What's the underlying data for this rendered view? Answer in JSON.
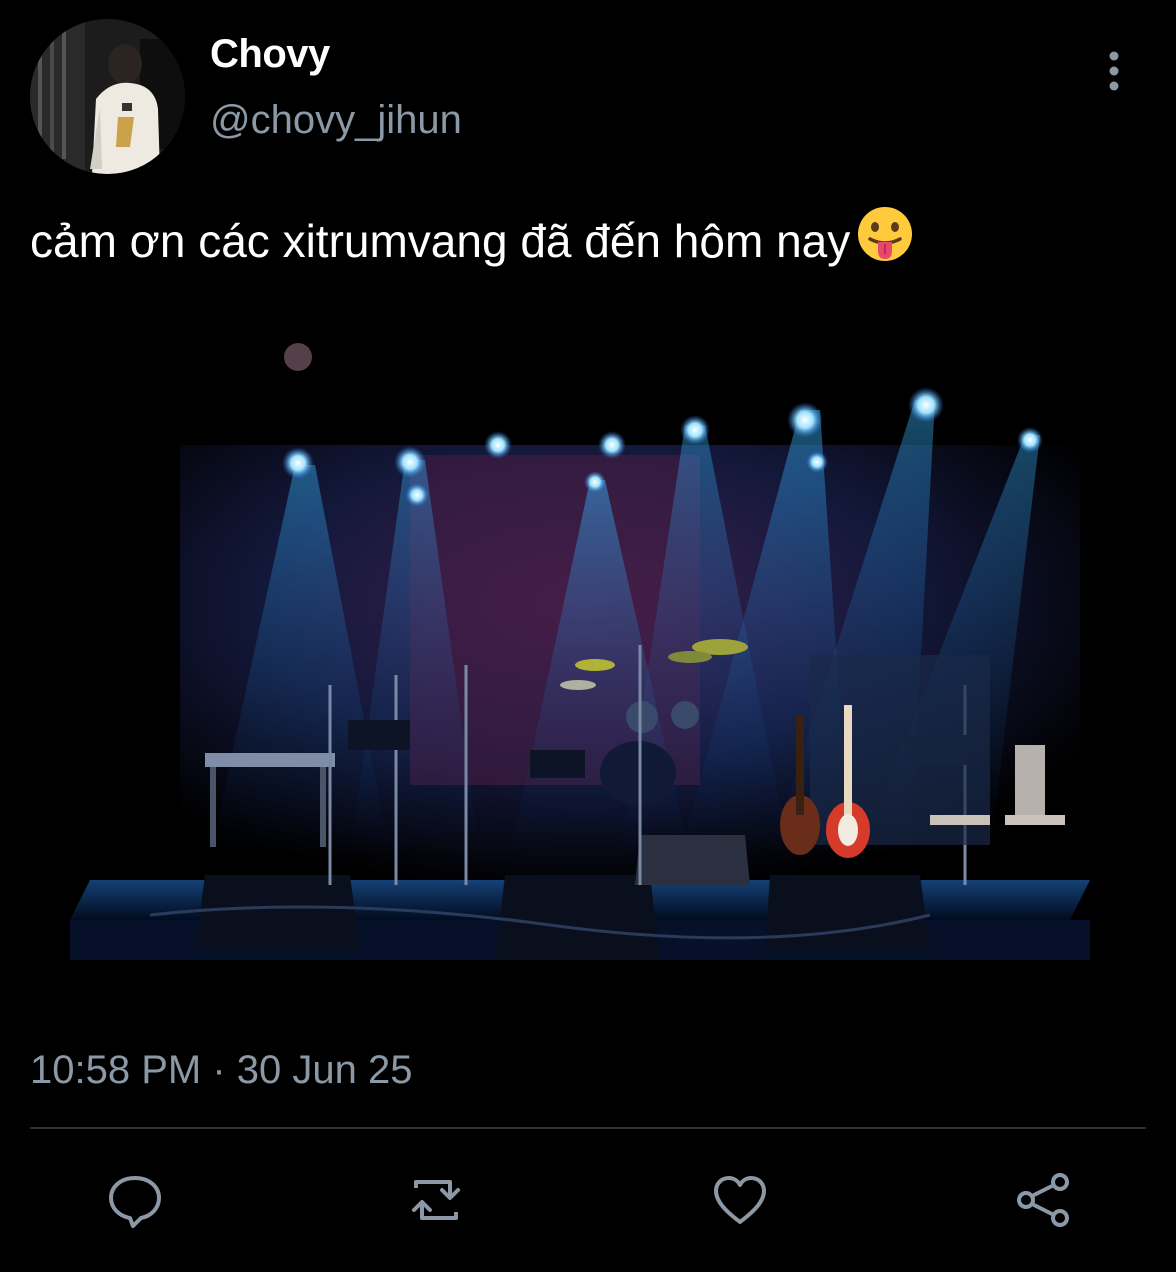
{
  "author": {
    "display_name": "Chovy",
    "handle": "@chovy_jihun",
    "avatar_icon": "profile-photo"
  },
  "tweet": {
    "text": "cảm ơn các xitrumvang đã đến hôm nay",
    "emoji": "face-with-tongue",
    "timestamp": "10:58 PM · 30 Jun 25",
    "media": "concert stage photo"
  },
  "actions": {
    "reply_icon": "comment-icon",
    "retweet_icon": "retweet-icon",
    "like_icon": "heart-icon",
    "share_icon": "share-icon"
  },
  "colors": {
    "background": "#000000",
    "text": "#ffffff",
    "secondary_text": "#8b98a5",
    "divider": "#2f3336"
  }
}
